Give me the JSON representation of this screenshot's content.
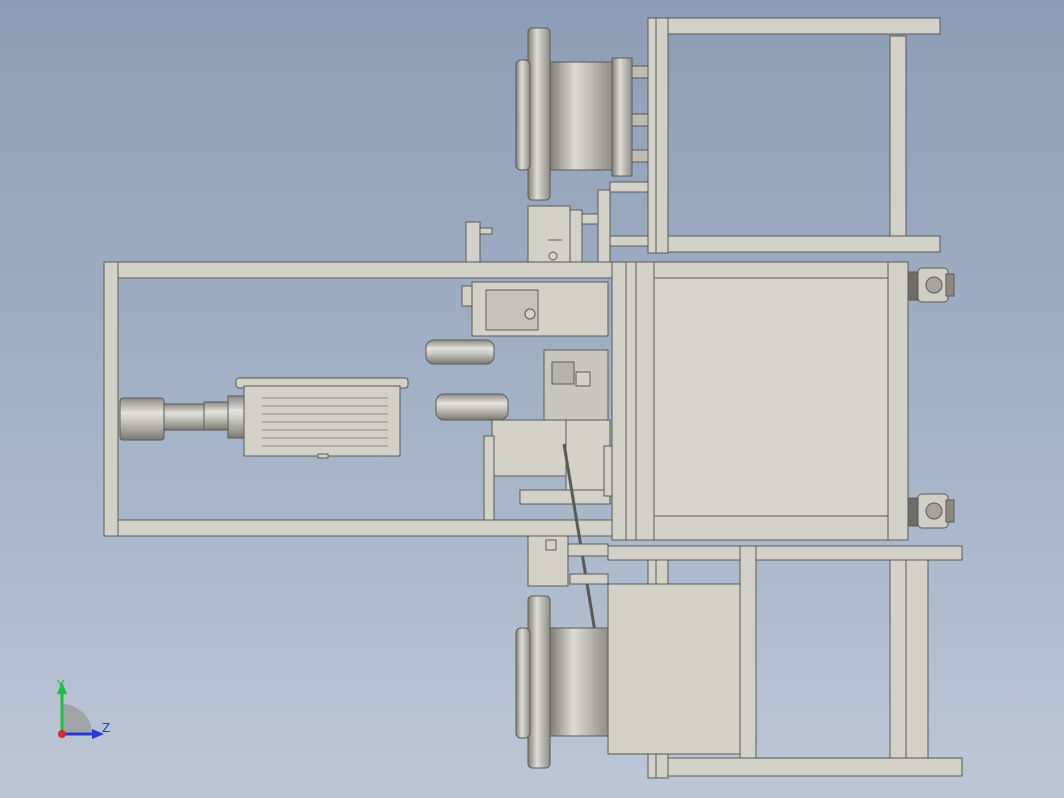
{
  "viewport": {
    "background_top": "#8d9db5",
    "background_bottom": "#bcc6d6"
  },
  "model": {
    "part_fill": "#d2d1c8",
    "part_shade": "#a5a49c",
    "part_edge": "#5a5a55",
    "dark_shade": "#6e6d67"
  },
  "triad": {
    "y_label": "Y",
    "z_label": "Z",
    "y_color": "#1fbf3a",
    "z_color": "#2238d8",
    "x_color": "#d42a2a"
  }
}
